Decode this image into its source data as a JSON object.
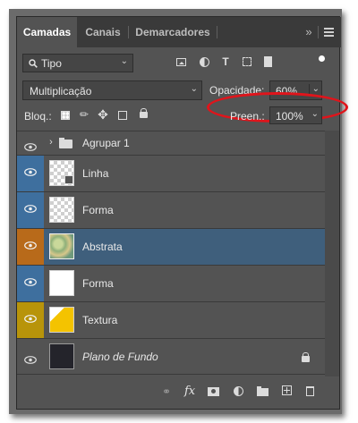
{
  "tabs": [
    {
      "label": "Camadas"
    },
    {
      "label": "Canais"
    },
    {
      "label": "Demarcadores"
    }
  ],
  "filter": {
    "value": "Tipo"
  },
  "blend_mode": {
    "value": "Multiplicação"
  },
  "opacity": {
    "label": "Opacidade:",
    "value": "60%"
  },
  "lock": {
    "label": "Bloq.:"
  },
  "fill": {
    "label": "Preen.:",
    "value": "100%"
  },
  "colors": {
    "blue": "#3e6f9e",
    "orange": "#b86a1a",
    "yellow": "#b8940a",
    "selected": "#3f5f7c",
    "panel": "#535353",
    "highlight": "#e0141b"
  },
  "layers": [
    {
      "name": "Agrupar 1",
      "type": "group",
      "tag": "none"
    },
    {
      "name": "Linha",
      "type": "shape",
      "tag": "blue"
    },
    {
      "name": "Forma",
      "type": "pattern",
      "tag": "blue"
    },
    {
      "name": "Abstrata",
      "type": "image",
      "tag": "orange",
      "selected": true
    },
    {
      "name": "Forma",
      "type": "white",
      "tag": "blue"
    },
    {
      "name": "Textura",
      "type": "texture",
      "tag": "yellow"
    },
    {
      "name": "Plano de Fundo",
      "type": "background",
      "tag": "none",
      "locked": true
    }
  ],
  "icons": {
    "panel_menu": "hamburger-icon",
    "collapse": "double-chevron-icon",
    "bottom": [
      "link-icon",
      "fx-icon",
      "mask-icon",
      "adjustment-icon",
      "folder-icon",
      "new-layer-icon",
      "trash-icon"
    ]
  },
  "fx_label": "fx"
}
